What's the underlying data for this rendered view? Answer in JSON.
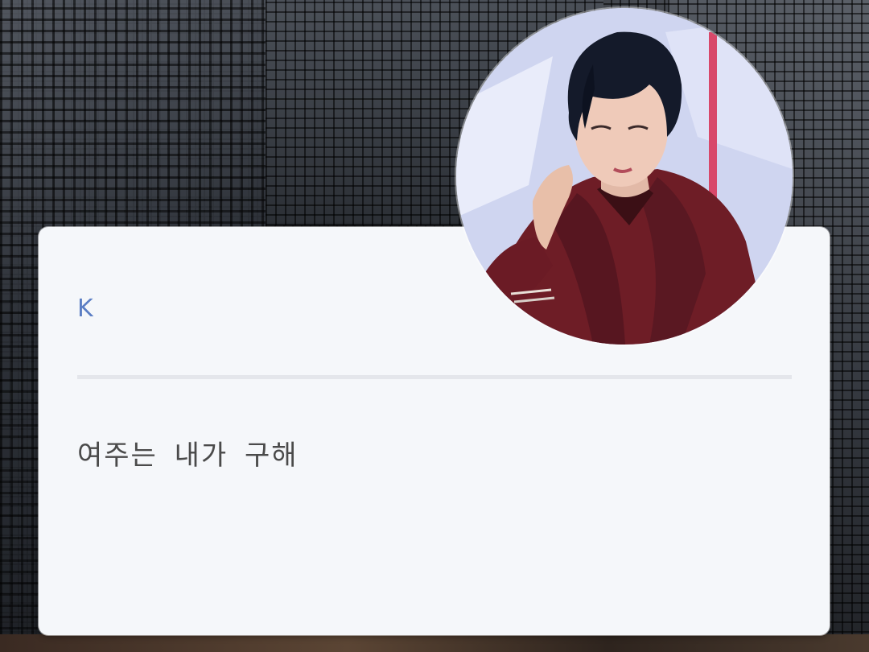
{
  "background": {
    "description_icon": "city-skyscraper-background"
  },
  "card": {
    "sender": "K",
    "message": "여주는 내가 구해"
  },
  "avatar": {
    "icon": "profile-photo-avatar"
  },
  "colors": {
    "card_background": "#f5f7fa",
    "sender_text": "#5b7ec4",
    "message_text": "#4a4a4a",
    "divider": "#e4e6eb"
  }
}
